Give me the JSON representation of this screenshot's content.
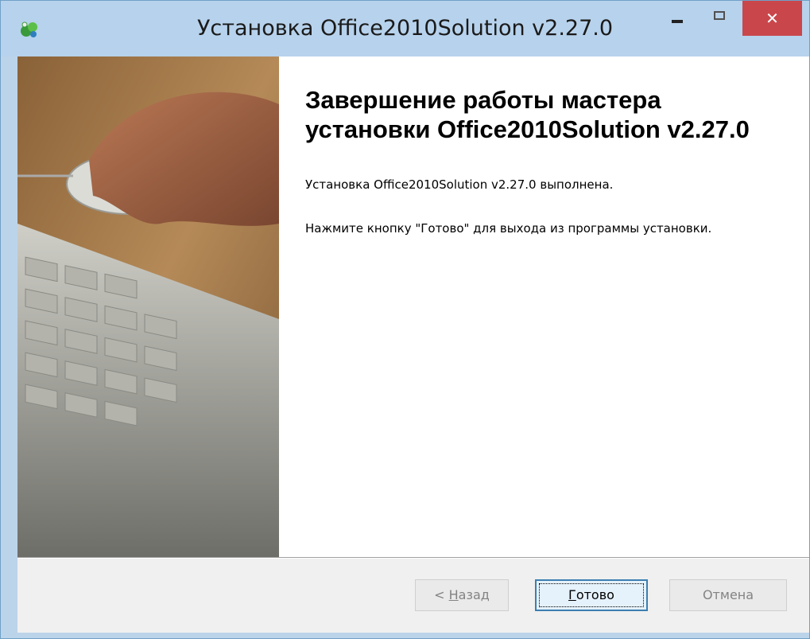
{
  "window": {
    "title": "Установка Office2010Solution v2.27.0",
    "controls": {
      "minimize_icon": "minimize-icon",
      "maximize_icon": "maximize-icon",
      "close_glyph": "✕"
    }
  },
  "page": {
    "heading": "Завершение работы мастера установки Office2010Solution v2.27.0",
    "line1": "Установка Office2010Solution v2.27.0 выполнена.",
    "line2": "Нажмите кнопку \"Готово\" для выхода из программы установки."
  },
  "buttons": {
    "back_prefix": "< ",
    "back_key": "Н",
    "back_rest": "азад",
    "finish_key": "Г",
    "finish_rest": "отово",
    "cancel": "Отмена"
  },
  "colors": {
    "titlebar": "#b7d2ec",
    "close": "#c9474b",
    "accent": "#3c7fb1"
  }
}
